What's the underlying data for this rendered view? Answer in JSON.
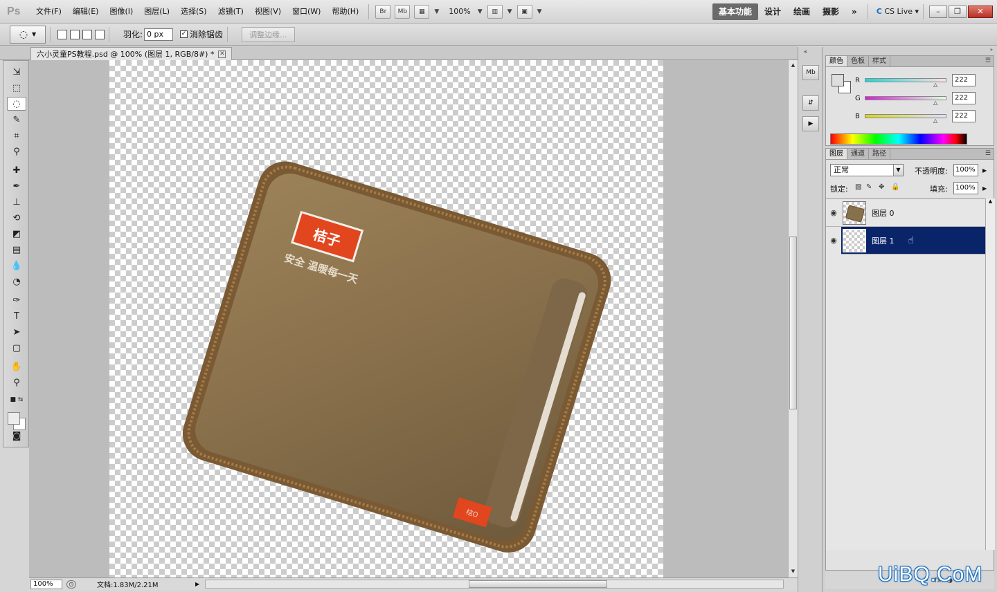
{
  "app": {
    "logo": "Ps"
  },
  "menu": [
    "文件(F)",
    "编辑(E)",
    "图像(I)",
    "图层(L)",
    "选择(S)",
    "滤镜(T)",
    "视图(V)",
    "窗口(W)",
    "帮助(H)"
  ],
  "appbar": {
    "bridge": "Br",
    "minibridge": "Mb",
    "zoom": "100%"
  },
  "workspaces": {
    "active": "基本功能",
    "items": [
      "设计",
      "绘画",
      "摄影"
    ],
    "more": "»"
  },
  "cslive": "CS Live",
  "options": {
    "feather_label": "羽化:",
    "feather_value": "0 px",
    "antialias_label": "消除锯齿",
    "antialias_checked": "✓",
    "refine_label": "调整边缘..."
  },
  "document": {
    "tab_title": "六小灵童PS教程.psd @ 100% (图层 1, RGB/8#) *",
    "status_zoom": "100%",
    "status_doc": "文档:1.83M/2.21M"
  },
  "product": {
    "brand": "桔子",
    "slogan": "安全  温暖每一天",
    "tag": "桔O"
  },
  "color_panel": {
    "tabs": [
      "颜色",
      "色板",
      "样式"
    ],
    "active_tab": "颜色",
    "r_label": "R",
    "g_label": "G",
    "b_label": "B",
    "r": "222",
    "g": "222",
    "b": "222"
  },
  "layers_panel": {
    "tabs": [
      "图层",
      "通道",
      "路径"
    ],
    "active_tab": "图层",
    "blend_mode": "正常",
    "opacity_label": "不透明度:",
    "opacity": "100%",
    "lock_label": "锁定:",
    "fill_label": "填充:",
    "fill": "100%",
    "layers": [
      {
        "name": "图层 0",
        "selected": false
      },
      {
        "name": "图层 1",
        "selected": true
      }
    ]
  },
  "watermark": "UiBQ.CoM",
  "colors": {
    "selection": "#0a246a",
    "product": "#8a7250",
    "brand_red": "#e2461e"
  }
}
